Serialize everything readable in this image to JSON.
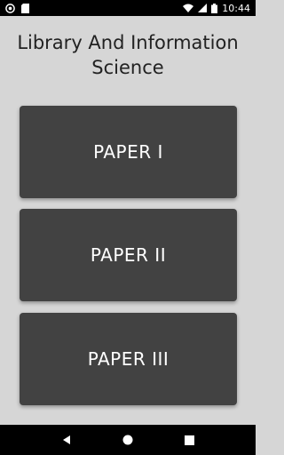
{
  "status_bar": {
    "time": "10:44",
    "left_icons": [
      "settings-icon",
      "sd-card-icon"
    ],
    "right_icons": [
      "wifi-icon",
      "cellular-signal-icon",
      "battery-icon"
    ]
  },
  "app": {
    "title": "Library And Information Science"
  },
  "papers": [
    {
      "label": "PAPER I"
    },
    {
      "label": "PAPER II"
    },
    {
      "label": "PAPER III"
    }
  ],
  "nav_bar": {
    "icons": [
      "back-icon",
      "home-icon",
      "recents-icon"
    ]
  },
  "colors": {
    "background": "#d6d6d6",
    "button": "#424242",
    "button_text": "#ffffff",
    "title_text": "#222222",
    "system_bars": "#000000"
  }
}
